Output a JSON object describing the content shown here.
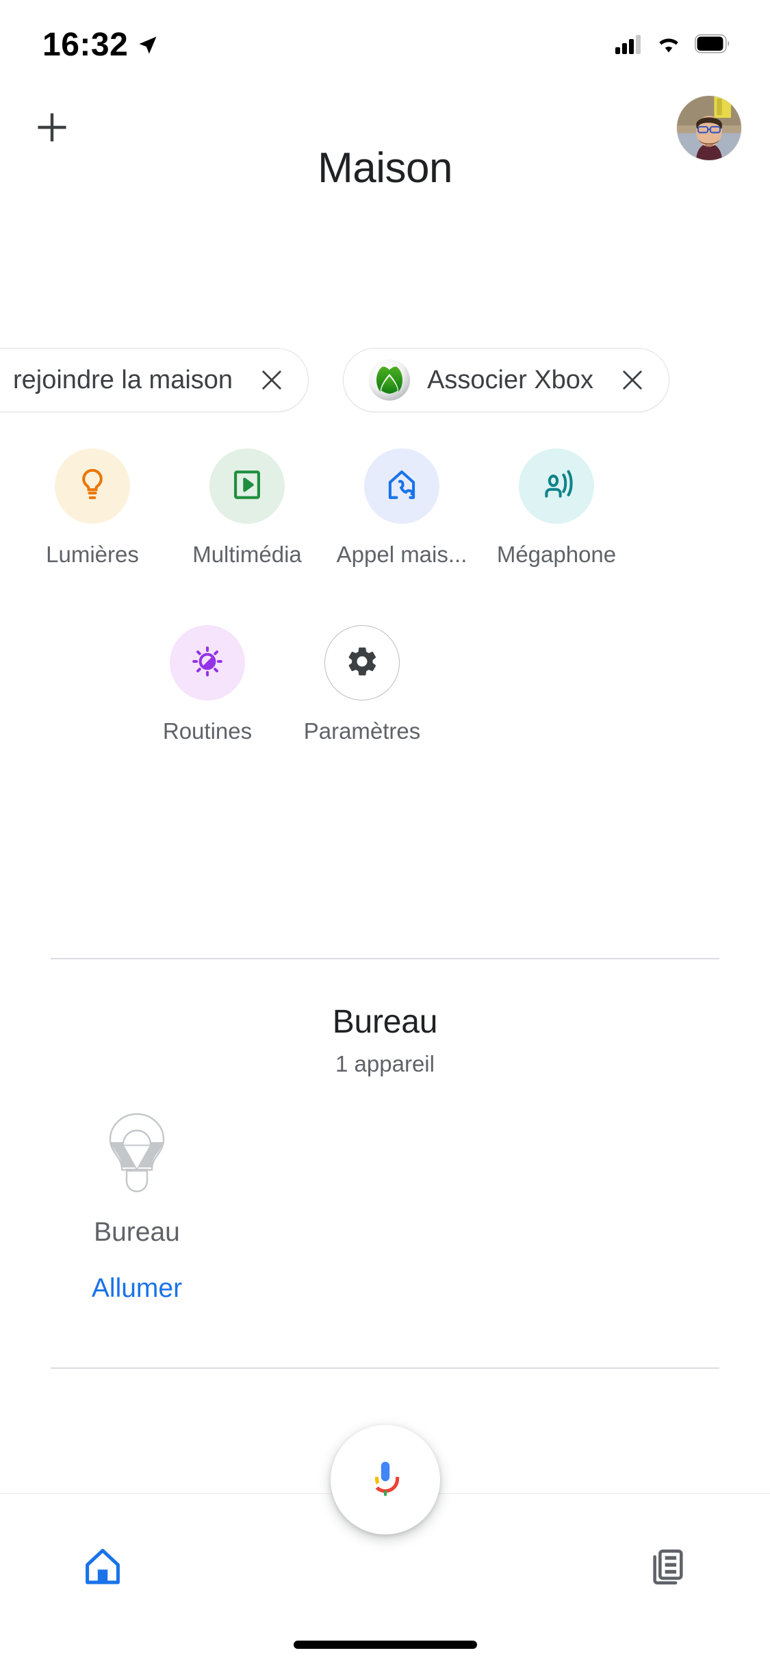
{
  "status_bar": {
    "time": "16:32",
    "location_icon": "location-arrow-icon",
    "signal_icon": "cellular-signal-icon",
    "wifi_icon": "wifi-icon",
    "battery_icon": "battery-full-icon"
  },
  "app_bar": {
    "add_icon": "plus-icon",
    "avatar_icon": "user-avatar-photo"
  },
  "header": {
    "title": "Maison"
  },
  "chips": [
    {
      "label": "rejoindre la maison",
      "icon": "invitation-icon",
      "dismiss_icon": "close-icon",
      "truncated_left": true
    },
    {
      "label": "Associer Xbox",
      "icon": "xbox-logo-icon",
      "dismiss_icon": "close-icon",
      "truncated_left": false
    }
  ],
  "quick_actions": {
    "row1": [
      {
        "label": "Lumières",
        "icon": "lightbulb-icon",
        "bg": "#FCF2DC",
        "fg": "#EA7601"
      },
      {
        "label": "Multimédia",
        "icon": "media-play-icon",
        "bg": "#E3F0E5",
        "fg": "#1E8E3E"
      },
      {
        "label": "Appel mais...",
        "icon": "home-call-icon",
        "bg": "#E6ECFB",
        "fg": "#1A73E8"
      },
      {
        "label": "Mégaphone",
        "icon": "broadcast-icon",
        "bg": "#DDF3F4",
        "fg": "#0F8389"
      }
    ],
    "row2": [
      {
        "label": "Routines",
        "icon": "routines-sun-icon",
        "bg": "#F5E4FB",
        "fg": "#9334E6"
      },
      {
        "label": "Paramètres",
        "icon": "gear-icon",
        "bg": "#FFFFFF",
        "fg": "#3C4043",
        "outline": true
      }
    ]
  },
  "room": {
    "name": "Bureau",
    "device_count_label": "1 appareil",
    "devices": [
      {
        "name": "Bureau",
        "icon": "light-bulb-off-icon",
        "action_label": "Allumer",
        "action_color": "#1a73e8"
      }
    ]
  },
  "bottom_nav": {
    "items": [
      {
        "name": "home",
        "icon": "home-icon",
        "active": true,
        "color": "#1a73e8"
      },
      {
        "name": "feed",
        "icon": "feed-icon",
        "active": false,
        "color": "#5f6368"
      }
    ],
    "assistant_button": {
      "icon": "google-assistant-mic-icon"
    }
  }
}
